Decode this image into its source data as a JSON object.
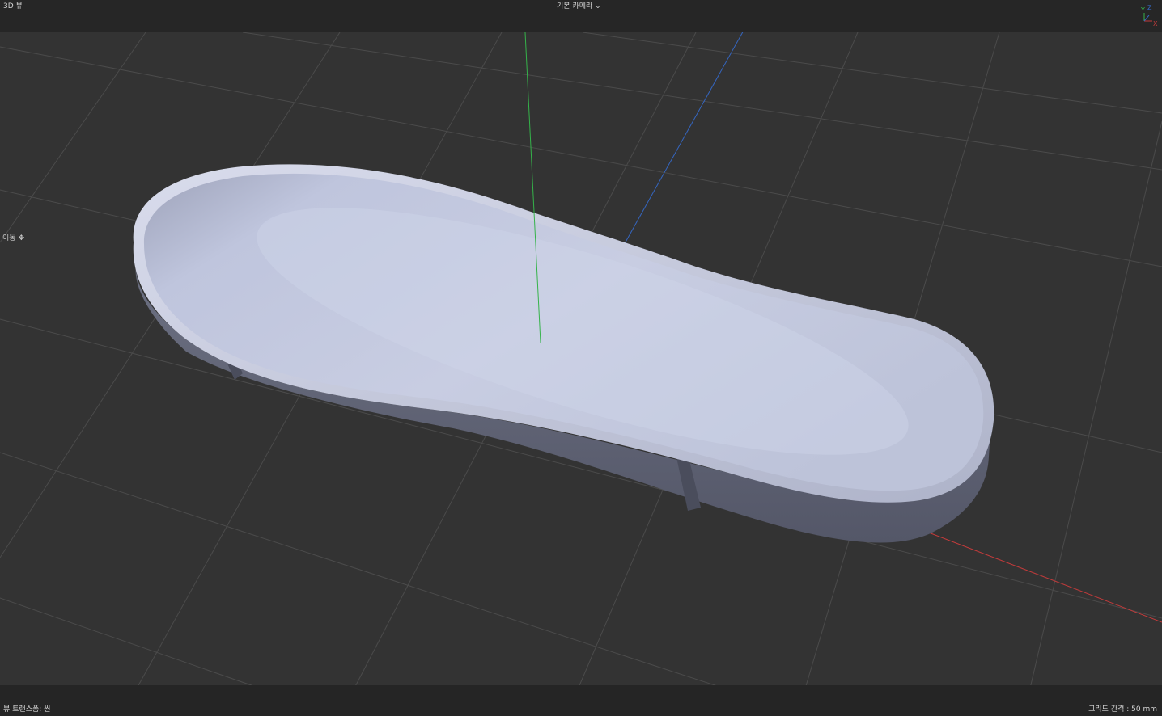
{
  "viewport": {
    "title": "3D 뷰",
    "camera": "기본 카메라 ⌄",
    "move_label": "이동",
    "move_icon": "✥",
    "view_transform": "뷰 트랜스폼: 씬",
    "grid_spacing": "그리드 간격 : 50 mm"
  },
  "gizmo": {
    "x_label": "X",
    "y_label": "Y",
    "z_label": "Z"
  },
  "colors": {
    "background": "#333333",
    "grid": "#4d4d4d",
    "axis_x": "#c23b3b",
    "axis_y": "#35b34a",
    "axis_z": "#3566c0",
    "model_top": "#c4cade",
    "model_side": "#5e6172"
  },
  "scene": {
    "object": "shoe-sole-tray"
  }
}
